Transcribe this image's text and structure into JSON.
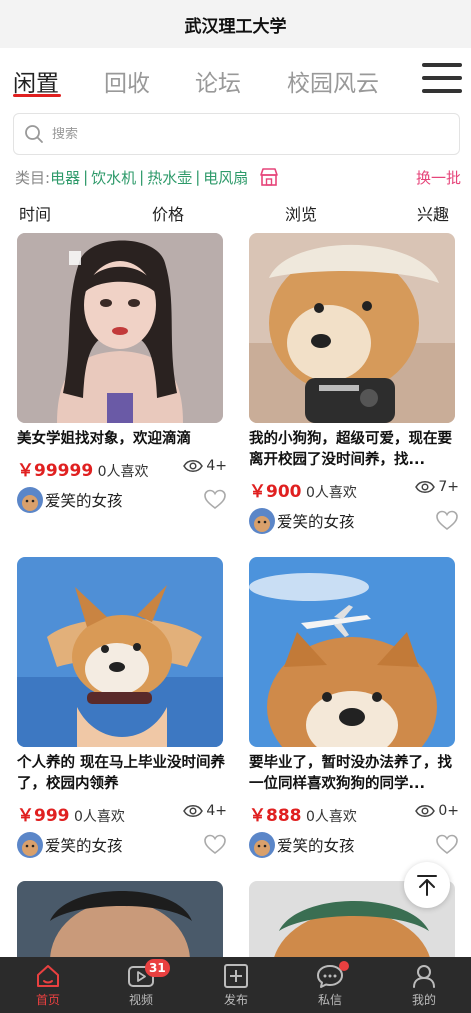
{
  "app": {
    "title": "武汉理工大学"
  },
  "tabs": [
    {
      "label": "闲置",
      "active": true
    },
    {
      "label": "回收",
      "active": false
    },
    {
      "label": "论坛",
      "active": false
    },
    {
      "label": "校园风云",
      "active": false
    }
  ],
  "search": {
    "placeholder": "搜索"
  },
  "categories": {
    "label": "类目:",
    "items": [
      "电器",
      "饮水机",
      "热水壶",
      "电风扇"
    ],
    "swap_label": "换一批"
  },
  "sort": [
    "时间",
    "价格",
    "浏览",
    "兴趣"
  ],
  "cards": [
    {
      "desc": "美女学姐找对象，欢迎滴滴",
      "price": "￥99999",
      "likes": "0人喜欢",
      "views": "4+",
      "user": "爱笑的女孩",
      "photo": "portrait-girl"
    },
    {
      "desc": "我的小狗狗，超级可爱，现在要离开校园了没时间养，找...",
      "price": "￥900",
      "likes": "0人喜欢",
      "views": "7+",
      "user": "爱笑的女孩",
      "photo": "shiba-with-towel"
    },
    {
      "desc": "个人养的 现在马上毕业没时间养了，校园内领养",
      "price": "￥999",
      "likes": "0人喜欢",
      "views": "4+",
      "user": "爱笑的女孩",
      "photo": "corgi-puppy"
    },
    {
      "desc": "要毕业了，暂时没办法养了，找一位同样喜欢狗狗的同学...",
      "price": "￥888",
      "likes": "0人喜欢",
      "views": "0+",
      "user": "爱笑的女孩",
      "photo": "shiba-with-airplane"
    }
  ],
  "bottom_nav": [
    {
      "label": "首页",
      "icon": "home-icon",
      "active": true
    },
    {
      "label": "视频",
      "icon": "video-icon",
      "badge": "31"
    },
    {
      "label": "发布",
      "icon": "plus-icon"
    },
    {
      "label": "私信",
      "icon": "chat-icon",
      "dot": true
    },
    {
      "label": "我的",
      "icon": "person-icon"
    }
  ],
  "colors": {
    "accent": "#e02020",
    "category": "#2e9a6a",
    "swap": "#e6457a",
    "tabbar": "#2b2b2b"
  }
}
